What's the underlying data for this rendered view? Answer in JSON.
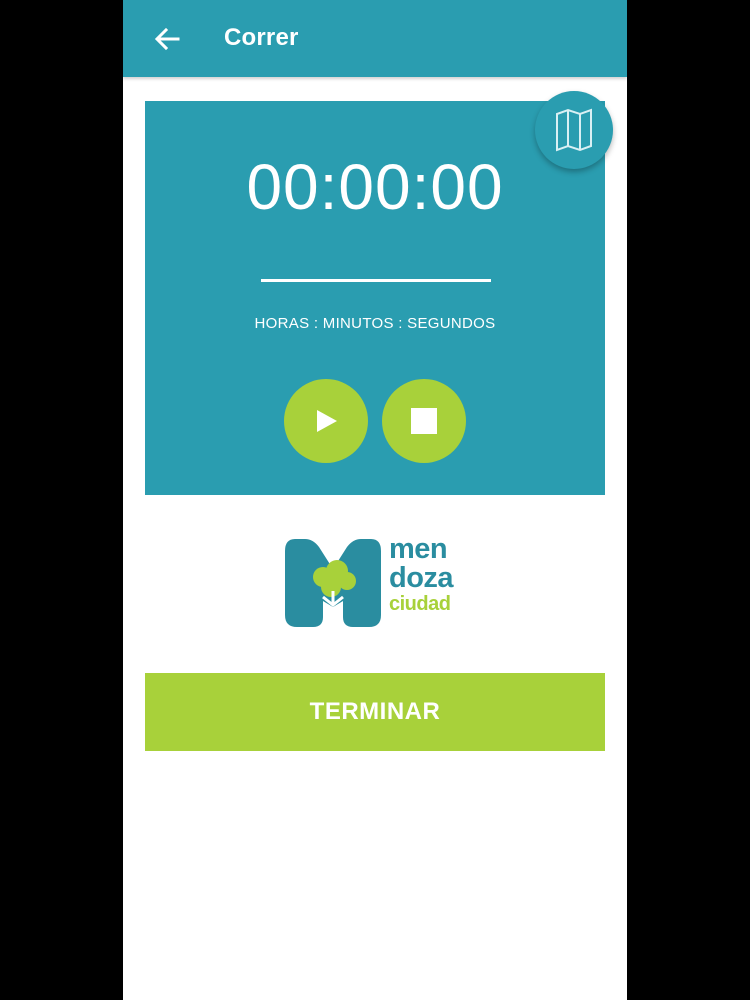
{
  "appbar": {
    "title": "Correr",
    "back_icon": "arrow-left-icon"
  },
  "map_button": {
    "icon": "folded-map-icon"
  },
  "timer": {
    "display": "00:00:00",
    "units_label": "HORAS : MINUTOS : SEGUNDOS"
  },
  "controls": {
    "play_icon": "play-icon",
    "stop_icon": "stop-icon"
  },
  "logo": {
    "line1": "men",
    "line2": "doza",
    "line3": "ciudad"
  },
  "footer": {
    "finish_label": "TERMINAR"
  },
  "colors": {
    "primary": "#2a9db0",
    "accent": "#a8d13a",
    "logo_teal": "#2a8da0"
  }
}
